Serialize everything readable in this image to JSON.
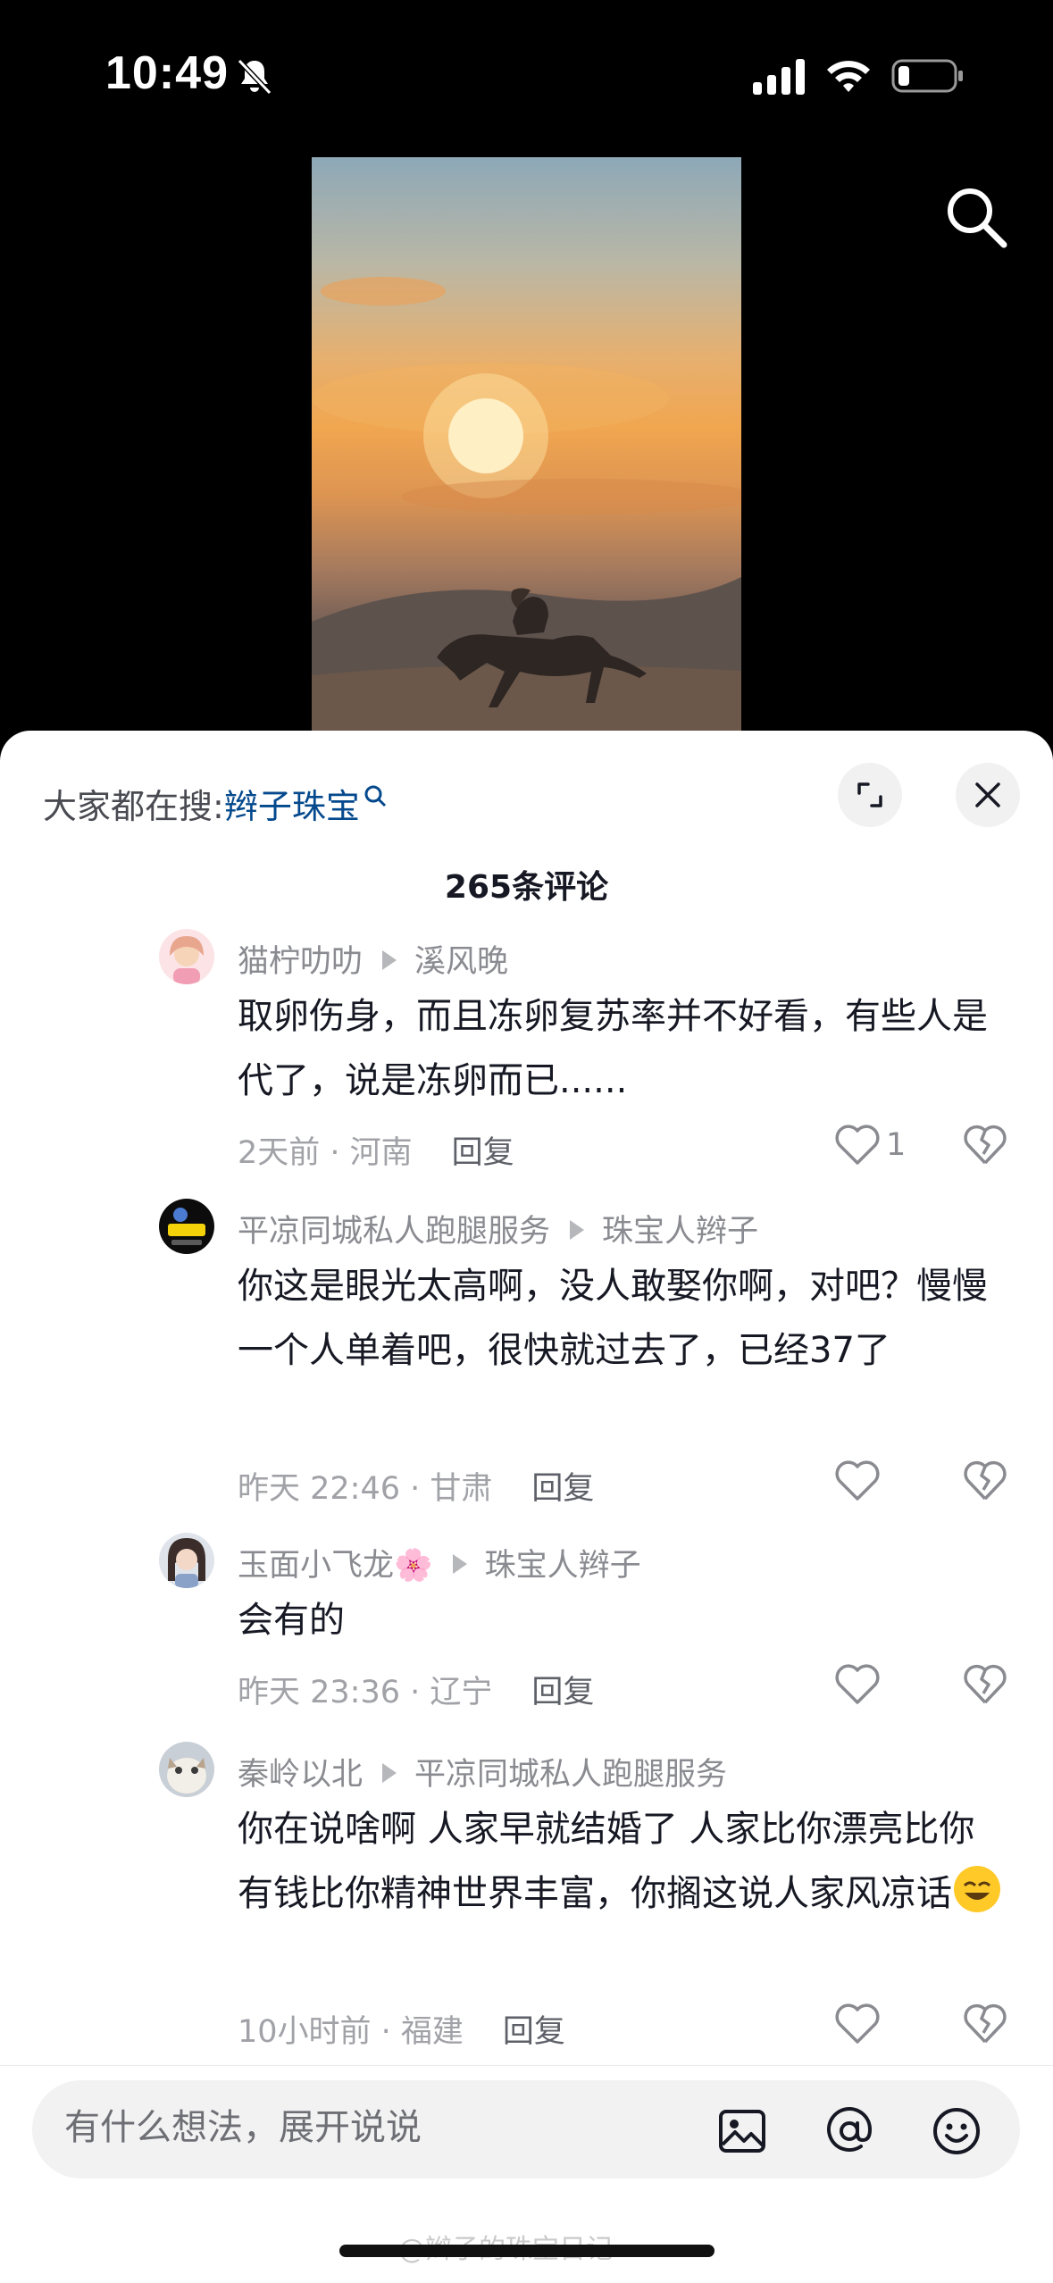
{
  "status_bar": {
    "time": "10:49"
  },
  "sheet": {
    "search_prefix": "大家都在搜:",
    "search_keyword": "辫子珠宝",
    "comment_count": "265条评论"
  },
  "comments": [
    {
      "user": "猫柠叻叻",
      "reply_to": "溪风晚",
      "text": "取卵伤身，而且冻卵复苏率并不好看，有些人是代了，说是冻卵而已......",
      "time_location": "2天前 · 河南",
      "reply_label": "回复",
      "likes": "1"
    },
    {
      "user": "平凉同城私人跑腿服务",
      "reply_to": "珠宝人辫子",
      "text": "你这是眼光太高啊，没人敢娶你啊，对吧？慢慢一个人单着吧，很快就过去了，已经37了",
      "time_location": "昨天 22:46 · 甘肃",
      "reply_label": "回复",
      "likes": ""
    },
    {
      "user": "玉面小飞龙🌸",
      "reply_to": "珠宝人辫子",
      "text": "会有的",
      "time_location": "昨天 23:36 · 辽宁",
      "reply_label": "回复",
      "likes": ""
    },
    {
      "user": "秦岭以北",
      "reply_to": "平凉同城私人跑腿服务",
      "text": "你在说啥啊 人家早就结婚了 人家比你漂亮比你有钱比你精神世界丰富，你搁这说人家风凉话",
      "time_location": "10小时前 · 福建",
      "reply_label": "回复",
      "likes": ""
    }
  ],
  "input": {
    "placeholder": "有什么想法，展开说说"
  },
  "watermark": "@辫子的珠宝日记",
  "colors": {
    "keyword": "#04498d",
    "sheet_bg": "#ffffff",
    "meta_text": "#a1a2a7"
  }
}
